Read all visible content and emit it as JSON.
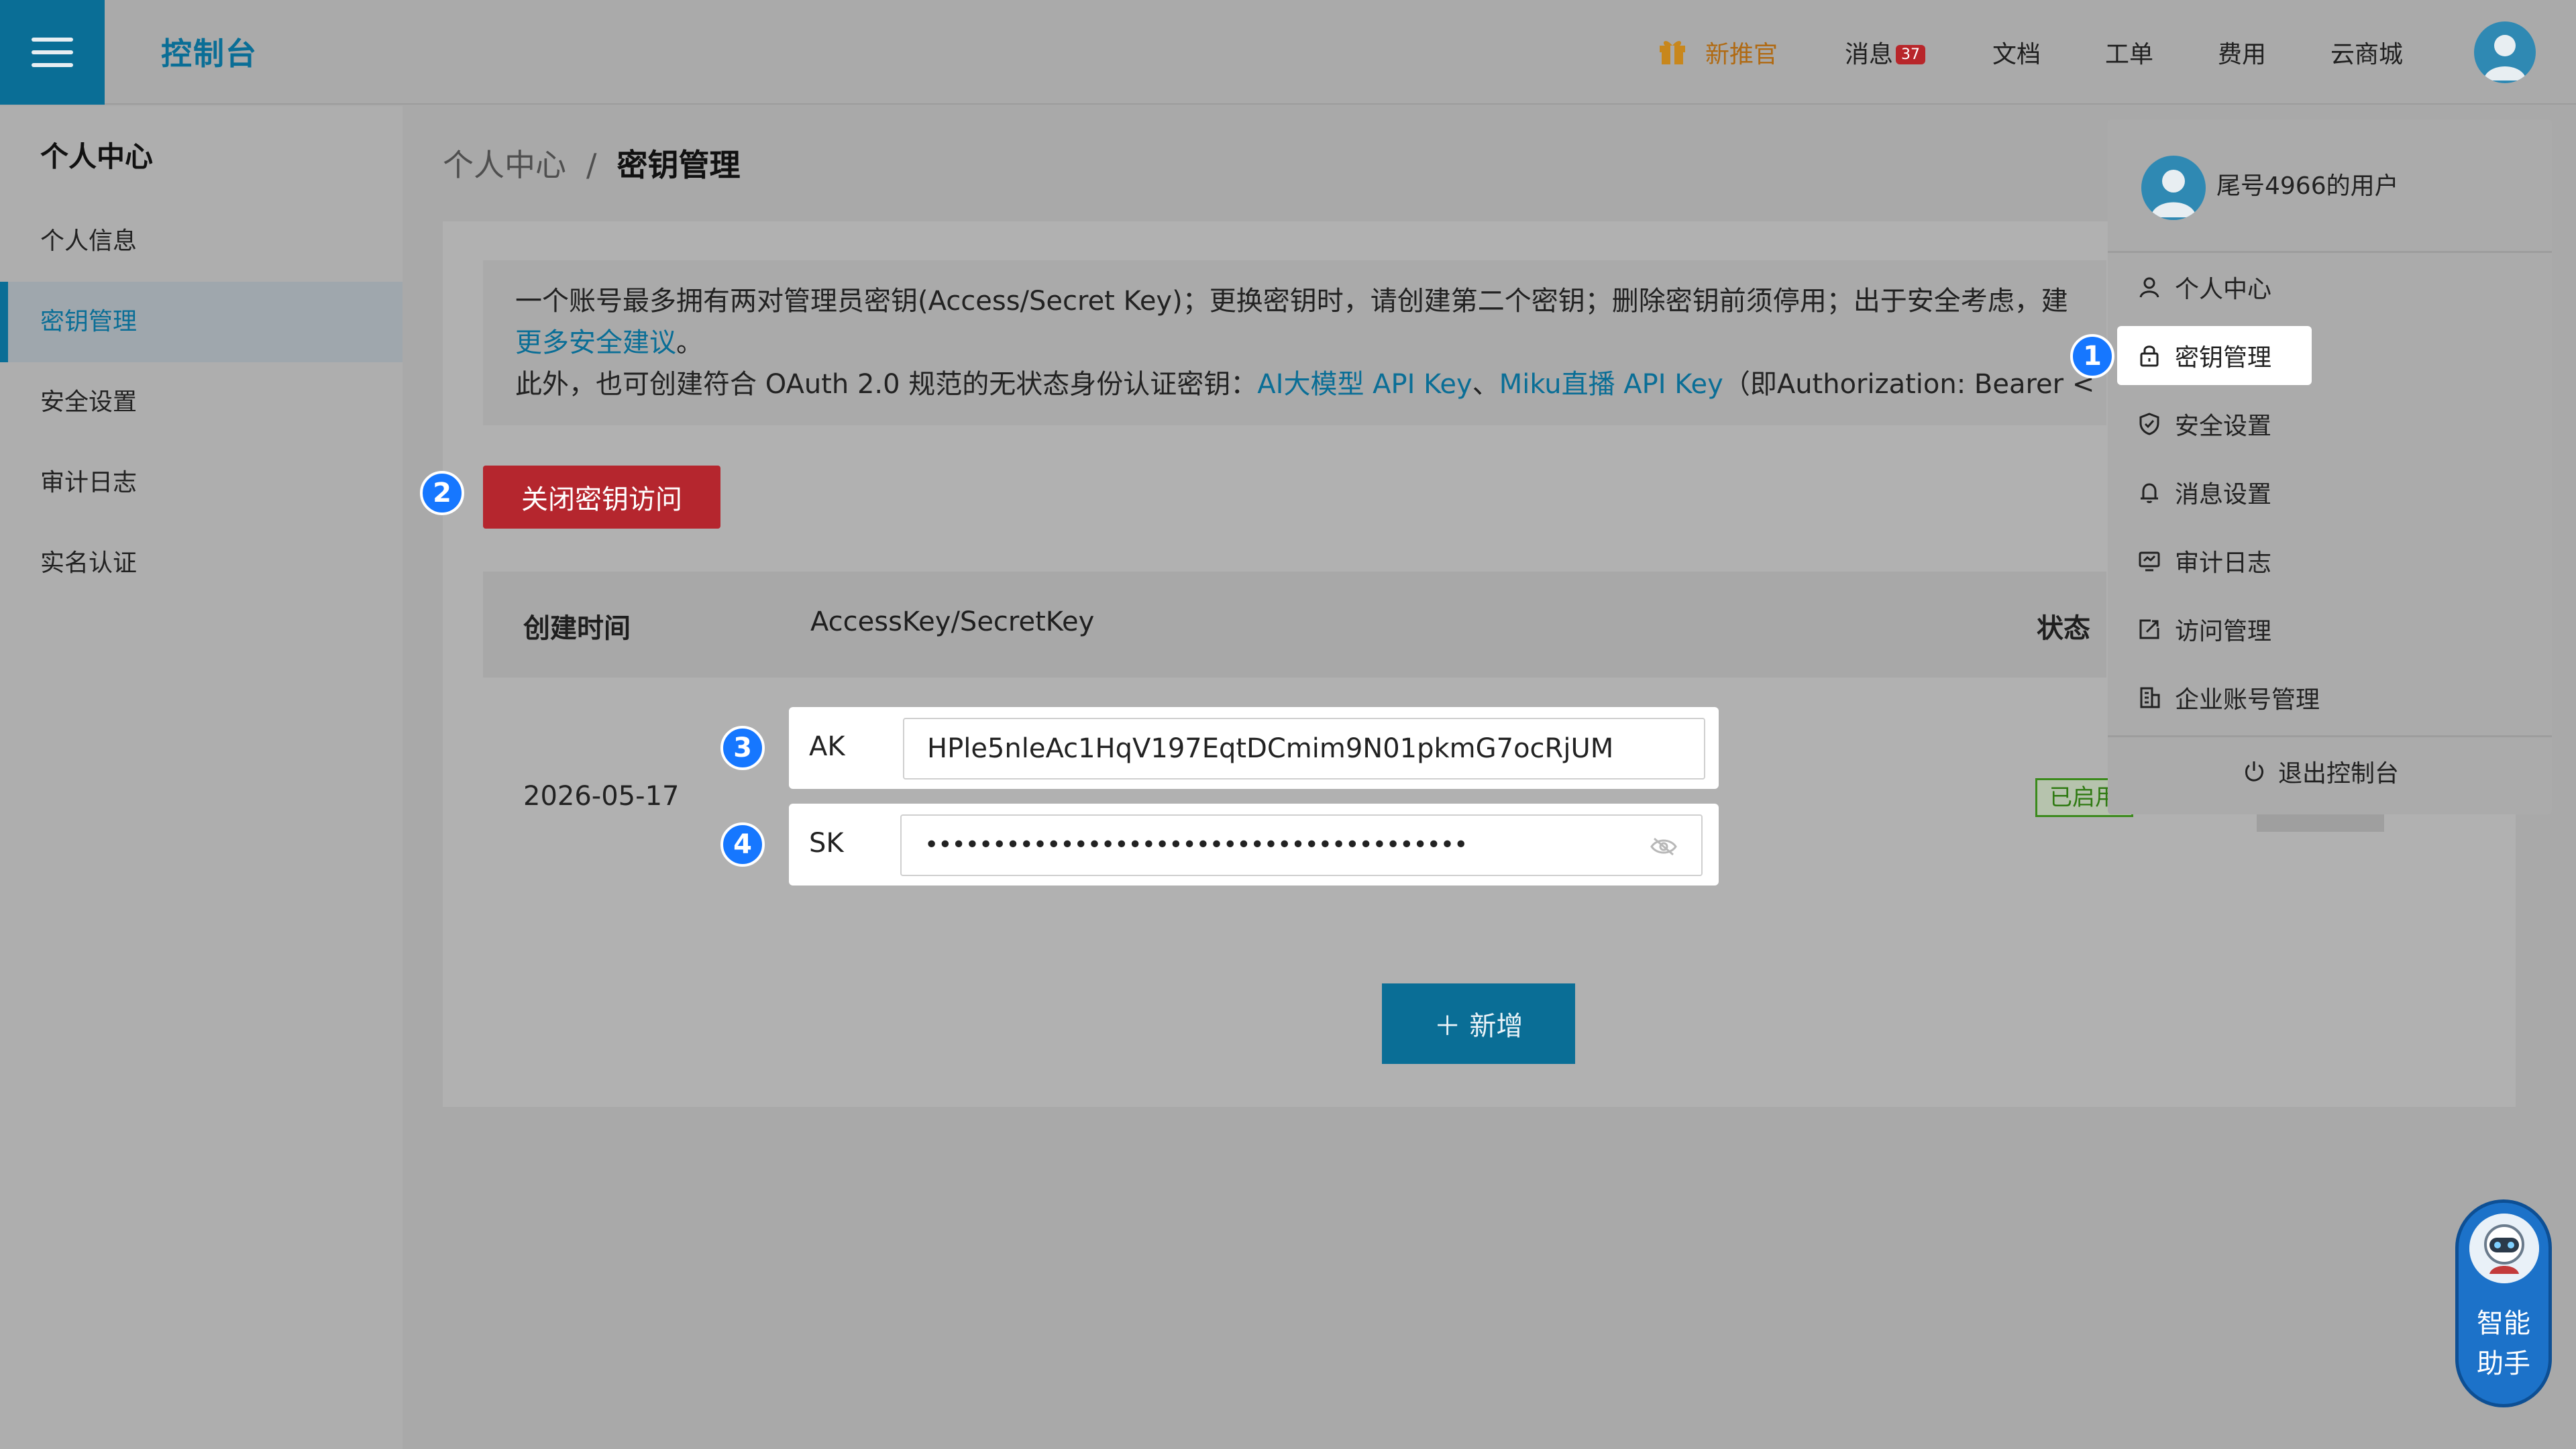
{
  "header": {
    "title": "控制台",
    "promo": "新推官",
    "nav": [
      "消息",
      "文档",
      "工单",
      "费用",
      "云商城"
    ],
    "message_count": "37"
  },
  "sidebar": {
    "title": "个人中心",
    "items": [
      "个人信息",
      "密钥管理",
      "安全设置",
      "审计日志",
      "实名认证"
    ],
    "active": "密钥管理"
  },
  "breadcrumb": {
    "parent": "个人中心",
    "separator": "/",
    "current": "密钥管理"
  },
  "notice": {
    "line1": "一个账号最多拥有两对管理员密钥(Access/Secret Key)；更换密钥时，请创建第二个密钥；删除密钥前须停用；出于安全考虑，建",
    "line2_link": "更多安全建议",
    "line2_end": "。",
    "line3_start": "此外，也可创建符合 OAuth 2.0 规范的无状态身份认证密钥：",
    "link_ai": "AI大模型 API Key",
    "link_sep": "、",
    "link_miku": "Miku直播 API Key",
    "line3_end": "（即Authorization: Bearer <"
  },
  "close_button": "关闭密钥访问",
  "table": {
    "headers": [
      "创建时间",
      "AccessKey/SecretKey",
      "状态"
    ],
    "row": {
      "date": "2026-05-17",
      "ak_label": "AK",
      "ak_value": "HPle5nleAc1HqV197EqtDCmim9N01pkmG7ocRjUM",
      "sk_label": "SK",
      "sk_value": "••••••••••••••••••••••••••••••••••••••••",
      "status": "已启用"
    }
  },
  "add_button": "＋ 新增",
  "steps": [
    "1",
    "2",
    "3",
    "4"
  ],
  "dropdown": {
    "username": "尾号4966的用户",
    "items": [
      {
        "label": "个人中心",
        "icon": "user-icon"
      },
      {
        "label": "密钥管理",
        "icon": "lock-icon"
      },
      {
        "label": "安全设置",
        "icon": "shield-icon"
      },
      {
        "label": "消息设置",
        "icon": "bell-icon"
      },
      {
        "label": "审计日志",
        "icon": "monitor-icon"
      },
      {
        "label": "访问管理",
        "icon": "access-icon"
      },
      {
        "label": "企业账号管理",
        "icon": "building-icon"
      }
    ],
    "logout": "退出控制台"
  },
  "assistant": {
    "line1": "智能",
    "line2": "助手"
  },
  "colors": {
    "brand": "#0a6e96",
    "danger": "#b5262e",
    "step": "#1677ff",
    "success": "#3b8a1c"
  }
}
